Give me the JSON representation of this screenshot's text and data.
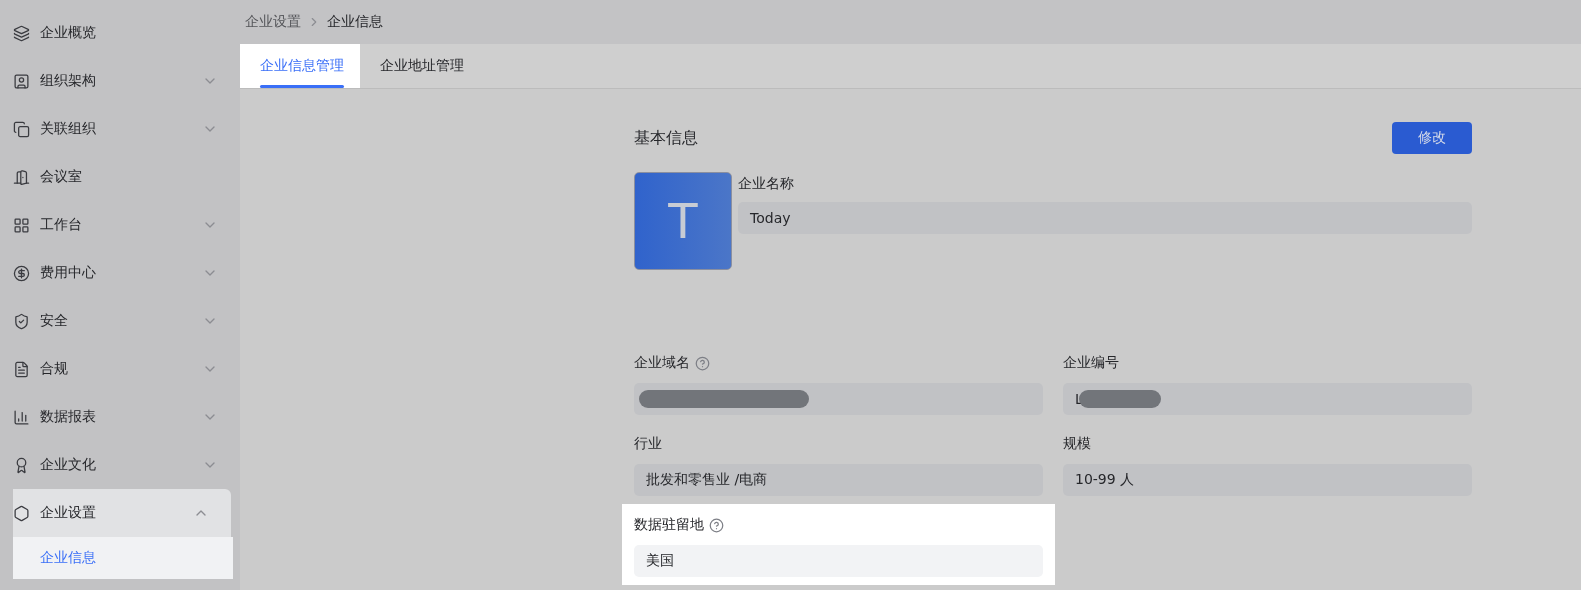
{
  "sidebar": {
    "items": [
      {
        "label": "企业概览",
        "highlighted": false
      },
      {
        "label": "组织架构",
        "expanded": false,
        "highlighted": false
      },
      {
        "label": "关联组织",
        "expanded": false,
        "highlighted": false
      },
      {
        "label": "会议室",
        "highlighted": false
      },
      {
        "label": "工作台",
        "expanded": false,
        "highlighted": false
      },
      {
        "label": "费用中心",
        "expanded": false,
        "highlighted": false
      },
      {
        "label": "安全",
        "expanded": false,
        "highlighted": false
      },
      {
        "label": "合规",
        "expanded": false,
        "highlighted": false
      },
      {
        "label": "数据报表",
        "expanded": false,
        "highlighted": false
      },
      {
        "label": "企业文化",
        "expanded": false,
        "highlighted": false
      },
      {
        "label": "企业设置",
        "expanded": true,
        "highlighted": true,
        "children": [
          {
            "label": "企业信息",
            "selected": true
          }
        ]
      }
    ]
  },
  "breadcrumb": [
    "企业设置",
    "企业信息"
  ],
  "tabs": [
    {
      "label": "企业信息管理",
      "selected": true
    },
    {
      "label": "企业地址管理",
      "selected": false
    }
  ],
  "section": {
    "title": "基本信息",
    "edit_button": "修改"
  },
  "logo": {
    "letter": "T"
  },
  "name_field": {
    "label": "企业名称",
    "value": "Today"
  },
  "fields": [
    {
      "label": "企业域名",
      "help": true,
      "redacted": true,
      "highlighted": false
    },
    {
      "label": "企业编号",
      "help": false,
      "value": "L",
      "redacted": true,
      "highlighted": false
    },
    {
      "label": "行业",
      "help": false,
      "value": "批发和零售业 /电商",
      "redacted": false,
      "highlighted": false
    },
    {
      "label": "规模",
      "help": false,
      "value": "10-99 人",
      "redacted": false,
      "highlighted": false
    },
    {
      "label": "数据驻留地",
      "help": true,
      "value": "美国",
      "redacted": false,
      "highlighted": true
    }
  ]
}
